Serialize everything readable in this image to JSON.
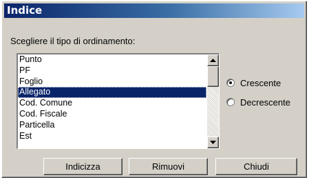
{
  "window": {
    "title": "Indice"
  },
  "prompt": "Scegliere il tipo di ordinamento:",
  "list": {
    "items": [
      "Punto",
      "PF",
      "Foglio",
      "Allegato",
      "Cod. Comune",
      "Cod. Fiscale",
      "Particella",
      "Est"
    ],
    "selected_index": 3
  },
  "order": {
    "options": [
      "Crescente",
      "Decrescente"
    ],
    "selected": "Crescente"
  },
  "buttons": {
    "indicizza": "Indicizza",
    "rimuovi": "Rimuovi",
    "chiudi": "Chiudi"
  },
  "icons": {
    "scroll_up": "arrow-up-icon",
    "scroll_down": "arrow-down-icon"
  },
  "colors": {
    "title_start": "#0a246a",
    "title_end": "#a6caf0",
    "selection": "#0a246a",
    "face": "#d4d0c8"
  }
}
